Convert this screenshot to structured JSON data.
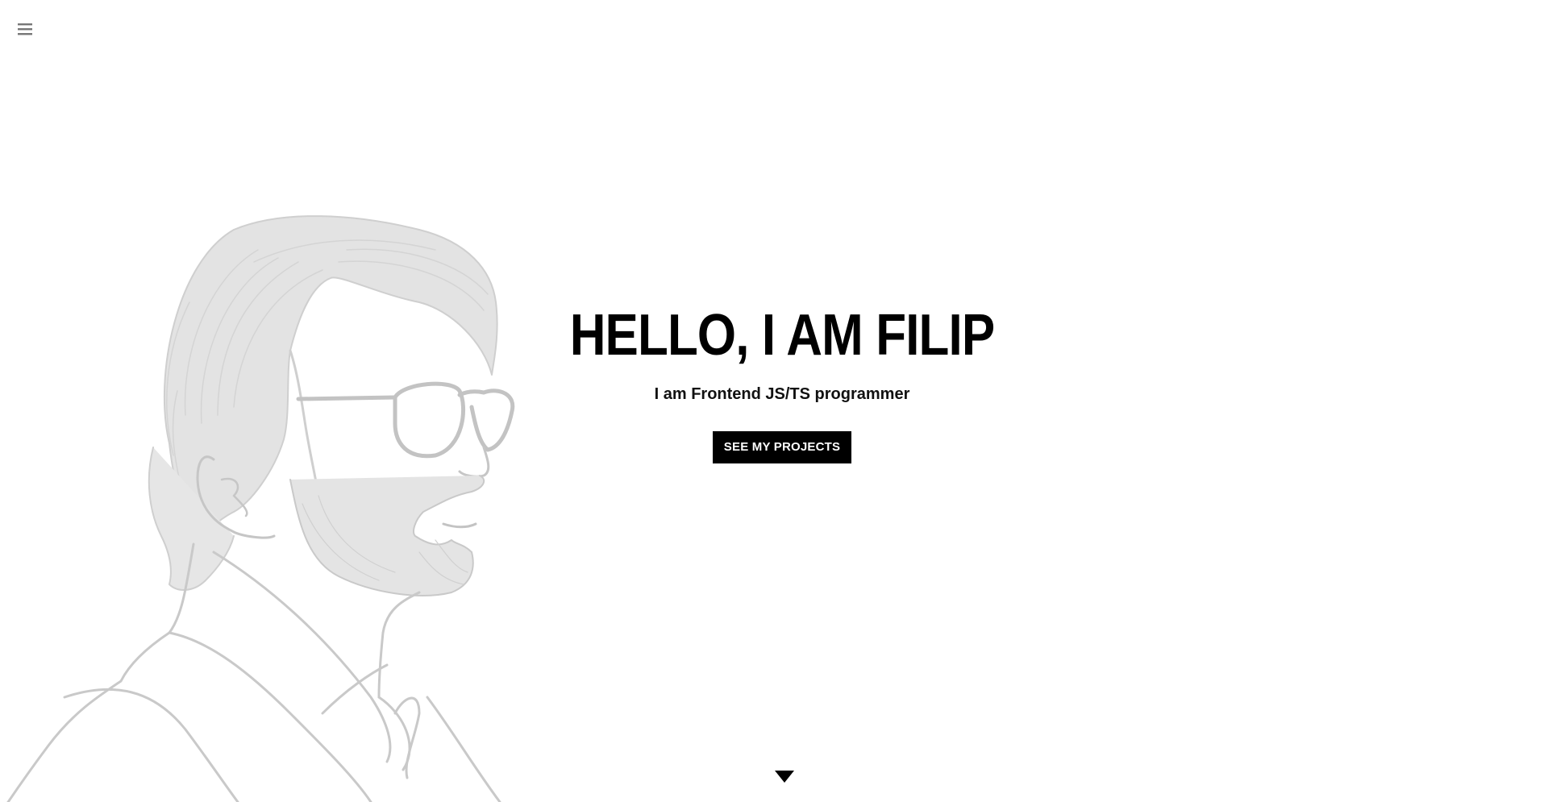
{
  "nav": {
    "menu_icon": "hamburger-menu-icon"
  },
  "hero": {
    "title": "HELLO, I AM FILIP",
    "subtitle": "I am Frontend JS/TS programmer",
    "cta_label": "SEE MY PROJECTS",
    "scroll_icon": "caret-down-icon"
  },
  "colors": {
    "background": "#ffffff",
    "text": "#000000",
    "illustration": "#c8c8c8",
    "button_bg": "#000000",
    "button_text": "#ffffff"
  }
}
